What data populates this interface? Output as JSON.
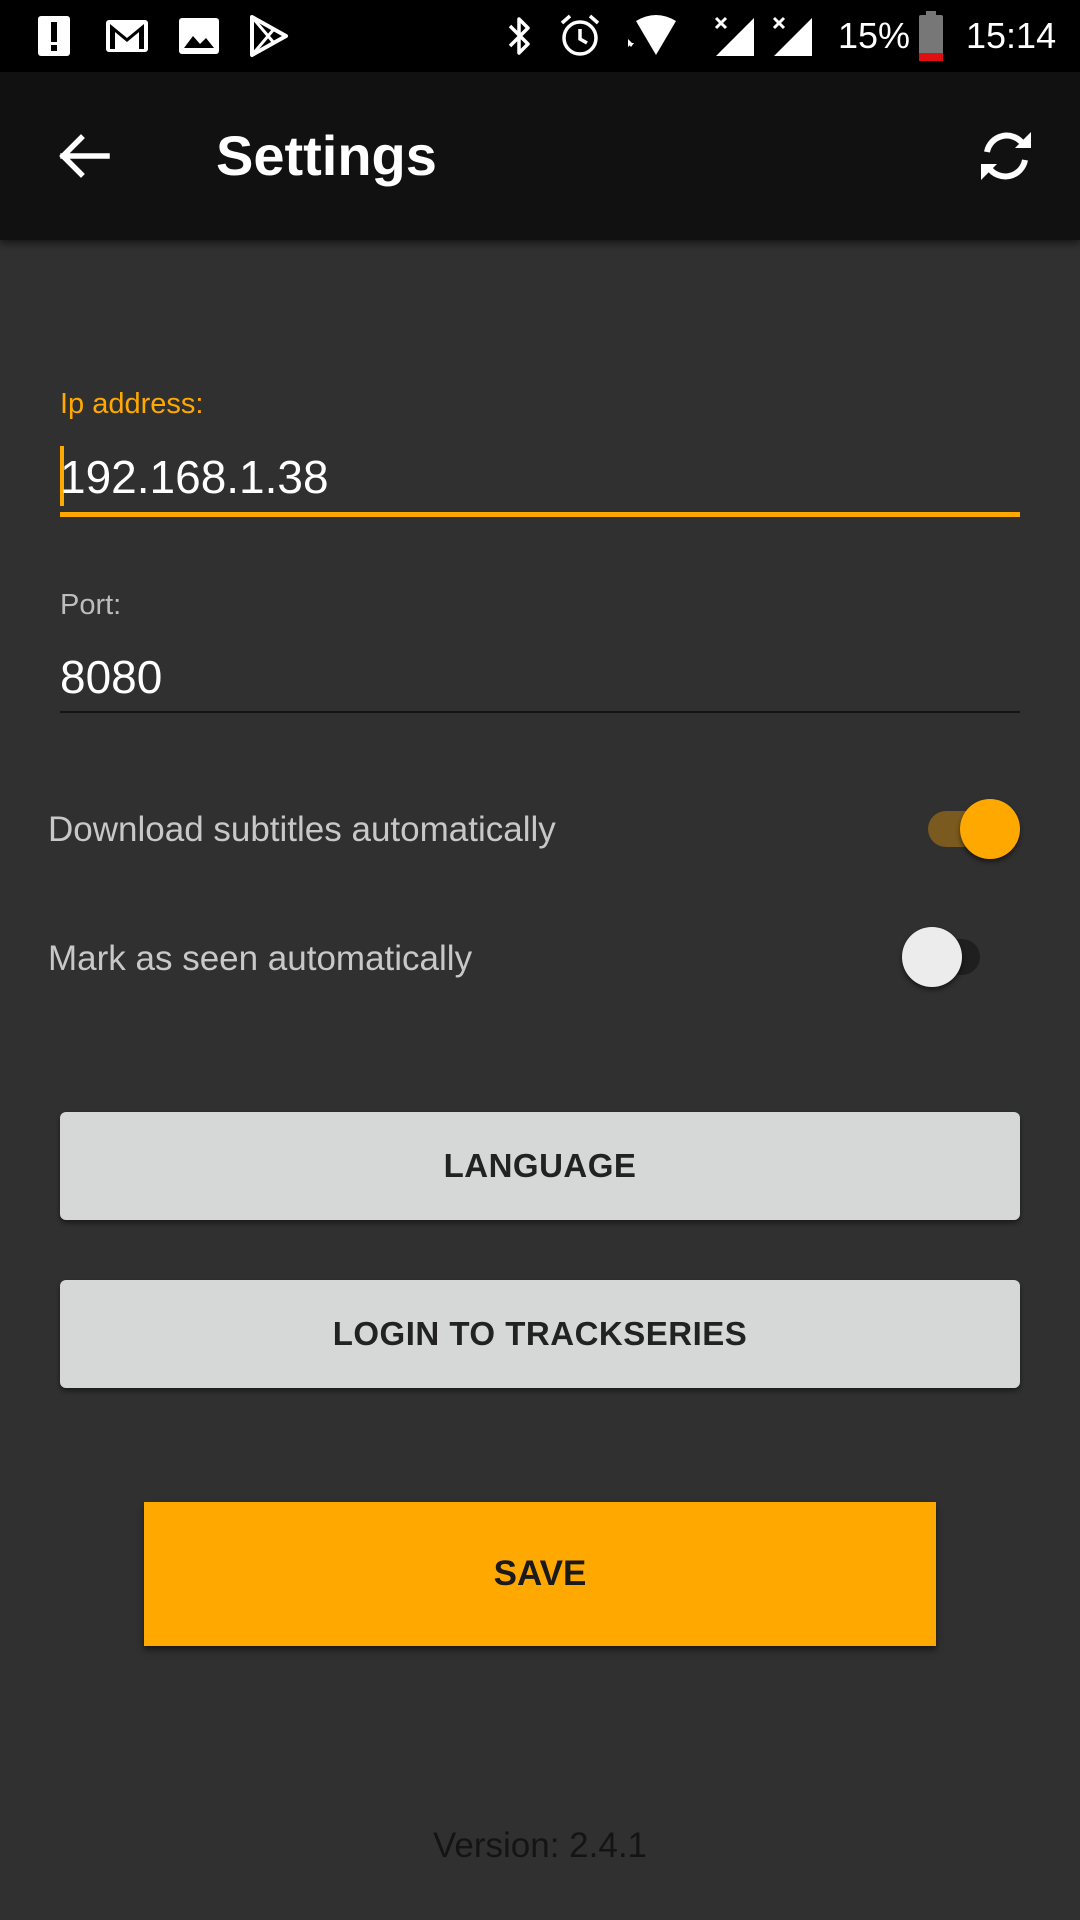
{
  "status_bar": {
    "battery_percent": "15%",
    "time": "15:14",
    "icons": [
      "alert-icon",
      "gmail-icon",
      "image-icon",
      "play-store-icon",
      "bluetooth-icon",
      "alarm-icon",
      "wifi-icon",
      "signal-icon",
      "signal-icon",
      "battery-icon"
    ]
  },
  "toolbar": {
    "title": "Settings",
    "back_icon": "arrow-left-icon",
    "sync_icon": "sync-icon"
  },
  "form": {
    "ip": {
      "label": "Ip address:",
      "value": "192.168.1.38"
    },
    "port": {
      "label": "Port:",
      "value": "8080"
    }
  },
  "switches": {
    "subtitles": {
      "label": "Download subtitles automatically",
      "on": true
    },
    "seen": {
      "label": "Mark as seen automatically",
      "on": false
    }
  },
  "buttons": {
    "language": "LANGUAGE",
    "login": "LOGIN TO TRACKSERIES",
    "save": "SAVE"
  },
  "footer": {
    "version": "Version: 2.4.1"
  },
  "colors": {
    "accent": "#ffa800",
    "background": "#303030",
    "toolbar": "#111111"
  }
}
